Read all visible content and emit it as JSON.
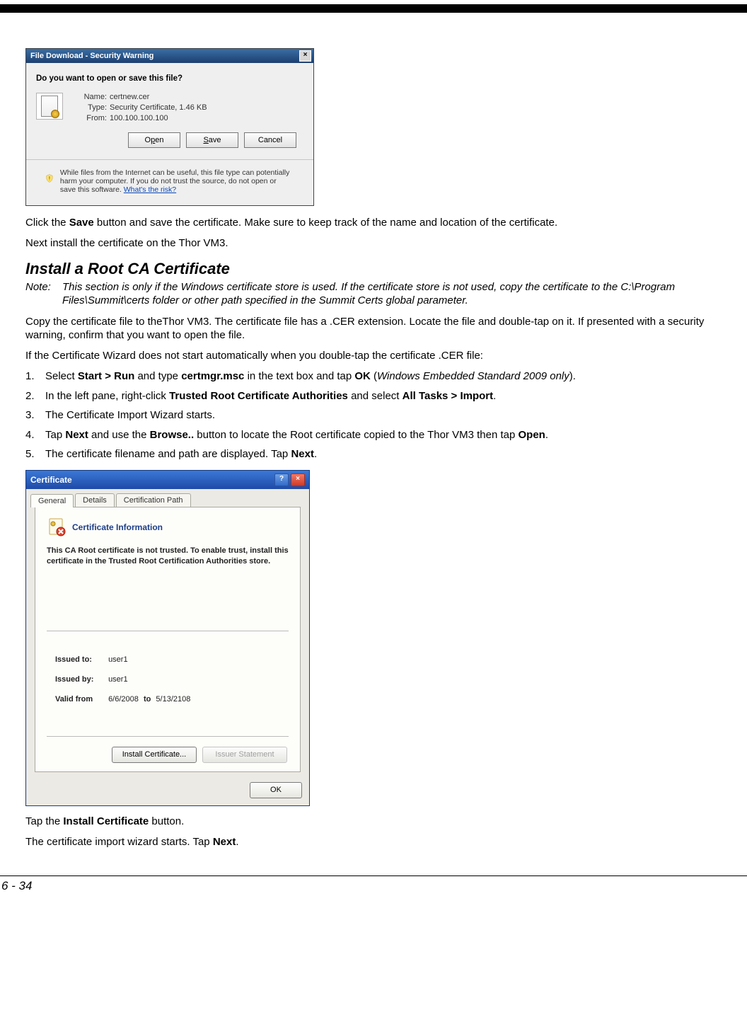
{
  "dlg1": {
    "title": "File Download - Security Warning",
    "question": "Do you want to open or save this file?",
    "meta": {
      "name_label": "Name:",
      "name_value": "certnew.cer",
      "type_label": "Type:",
      "type_value": "Security Certificate, 1.46 KB",
      "from_label": "From:",
      "from_value": "100.100.100.100"
    },
    "buttons": {
      "open_pre": "O",
      "open_mn": "p",
      "open_post": "en",
      "save_pre": "",
      "save_mn": "S",
      "save_post": "ave",
      "cancel": "Cancel"
    },
    "warning_text": "While files from the Internet can be useful, this file type can potentially harm your computer. If you do not trust the source, do not open or save this software. ",
    "warning_link": "What's the risk?"
  },
  "body": {
    "para1_pre": "Click the ",
    "para1_bold": "Save",
    "para1_post": " button and save the certificate. Make sure to keep track of the name and location of the certificate.",
    "para2": "Next install the certificate on the Thor VM3.",
    "h2": "Install a Root CA Certificate",
    "note_label": "Note:",
    "note_text": "This section is only if the Windows certificate store is used. If the certificate store is not used, copy the certificate to the C:\\Program Files\\Summit\\certs folder or other path specified in the Summit Certs global parameter.",
    "para3": "Copy the certificate file to theThor VM3.  The certificate file has a .CER extension.  Locate the file and double-tap on it.  If presented with a security warning, confirm that you want to open the file.",
    "para4": "If the Certificate Wizard does not start automatically when you double-tap the certificate .CER file:",
    "ol": [
      {
        "n": "1.",
        "pre": "Select ",
        "b1": "Start > Run",
        "mid1": " and type ",
        "b2": "certmgr.msc",
        "mid2": " in the text box and tap ",
        "b3": "OK",
        "mid3": " (",
        "i1": "Windows Embedded Standard 2009 only",
        "post": ")."
      },
      {
        "n": "2.",
        "pre": "In the left pane, right-click ",
        "b1": "Trusted Root Certificate Authorities",
        "mid1": " and select ",
        "b2": "All Tasks > Import",
        "post": "."
      },
      {
        "n": "3.",
        "pre": "The Certificate Import Wizard starts."
      },
      {
        "n": "4.",
        "pre": "Tap ",
        "b1": "Next",
        "mid1": " and use the ",
        "b2": "Browse..",
        "mid2": " button to locate the Root certificate copied to the Thor VM3 then tap ",
        "b3": "Open",
        "post": "."
      },
      {
        "n": "5.",
        "pre": "The certificate filename and path are displayed. Tap ",
        "b1": "Next",
        "post": "."
      }
    ]
  },
  "dlg2": {
    "title": "Certificate",
    "tabs": {
      "general": "General",
      "details": "Details",
      "certpath": "Certification Path"
    },
    "heading": "Certificate Information",
    "trust_text": "This CA Root certificate is not trusted. To enable trust, install this certificate in the Trusted Root Certification Authorities store.",
    "issued_to_label": "Issued to:",
    "issued_to_value": "user1",
    "issued_by_label": "Issued by:",
    "issued_by_value": "user1",
    "valid_from_label": "Valid from",
    "valid_from_value": "6/6/2008",
    "valid_to_label": "to",
    "valid_to_value": "5/13/2108",
    "btn_install": "Install Certificate...",
    "btn_issuer": "Issuer Statement",
    "btn_ok": "OK"
  },
  "tail": {
    "p1_pre": "Tap the ",
    "p1_bold": "Install Certificate",
    "p1_post": " button.",
    "p2_pre": "The certificate import wizard starts. Tap ",
    "p2_bold": "Next",
    "p2_post": "."
  },
  "page_number": "6 - 34"
}
